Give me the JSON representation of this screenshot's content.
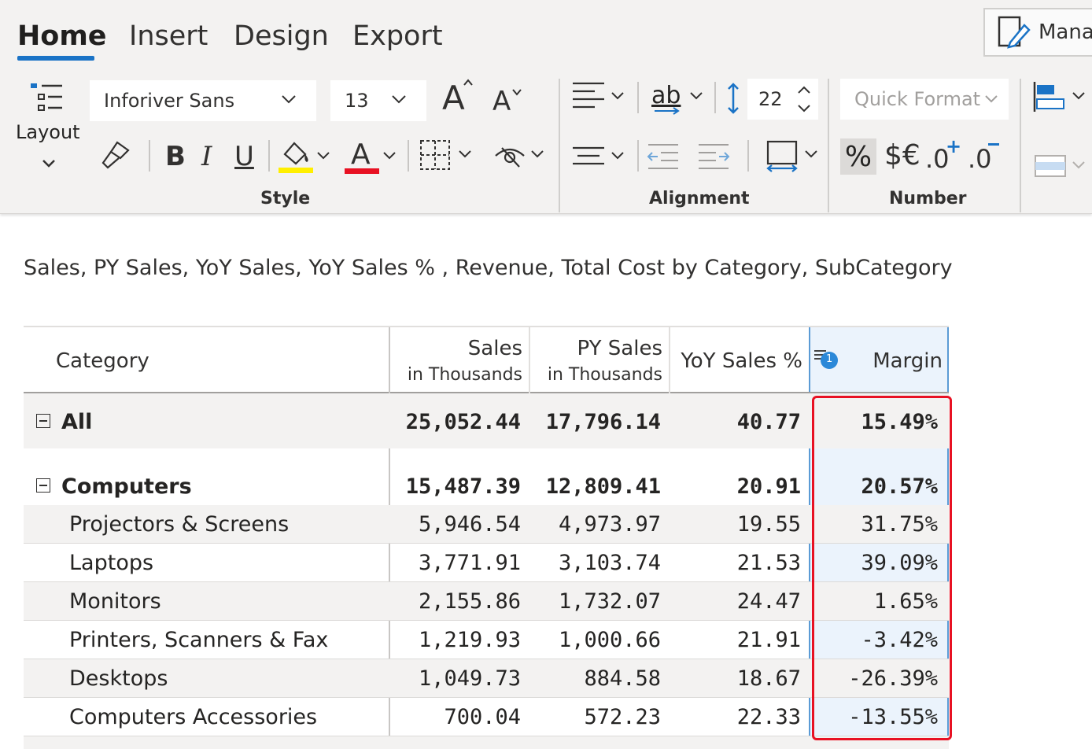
{
  "tabs": [
    {
      "label": "Home",
      "active": true
    },
    {
      "label": "Insert",
      "active": false
    },
    {
      "label": "Design",
      "active": false
    },
    {
      "label": "Export",
      "active": false
    }
  ],
  "manage_button": {
    "label": "Manag"
  },
  "ribbon": {
    "layout_label": "Layout",
    "font_family": "Inforiver Sans",
    "font_size": "13",
    "bold_label": "B",
    "italic_label": "I",
    "underline_label": "U",
    "increase_font": "A",
    "decrease_font": "A",
    "font_color_letter": "A",
    "wrap_label": "ab",
    "row_height": "22",
    "quick_format_placeholder": "Quick Format",
    "percent_label": "%",
    "currency_label": "$€",
    "inc_decimal_label": ".0",
    "dec_decimal_label": ".0",
    "groups": {
      "style": "Style",
      "alignment": "Alignment",
      "number": "Number"
    }
  },
  "colors": {
    "accent": "#1a73c6",
    "highlight_fill": "#ffef00",
    "font_color_bar": "#e81123",
    "selection_border": "#e81123",
    "margin_column_border": "#5b9bd5"
  },
  "report": {
    "subtitle": "Sales, PY Sales, YoY Sales, YoY Sales % , Revenue, Total Cost by Category, SubCategory",
    "sort_badge": "1",
    "columns": [
      {
        "label": "Category",
        "sub": ""
      },
      {
        "label": "Sales",
        "sub": "in Thousands"
      },
      {
        "label": "PY Sales",
        "sub": "in Thousands"
      },
      {
        "label": "YoY Sales %",
        "sub": ""
      },
      {
        "label": "Margin",
        "sub": ""
      }
    ],
    "rows": [
      {
        "category": "All",
        "sales": "25,052.44",
        "py_sales": "17,796.14",
        "yoy": "40.77",
        "margin": "15.49%"
      },
      {
        "category": "Computers",
        "sales": "15,487.39",
        "py_sales": "12,809.41",
        "yoy": "20.91",
        "margin": "20.57%"
      },
      {
        "category": "Projectors & Screens",
        "sales": "5,946.54",
        "py_sales": "4,973.97",
        "yoy": "19.55",
        "margin": "31.75%"
      },
      {
        "category": "Laptops",
        "sales": "3,771.91",
        "py_sales": "3,103.74",
        "yoy": "21.53",
        "margin": "39.09%"
      },
      {
        "category": "Monitors",
        "sales": "2,155.86",
        "py_sales": "1,732.07",
        "yoy": "24.47",
        "margin": "1.65%"
      },
      {
        "category": "Printers, Scanners & Fax",
        "sales": "1,219.93",
        "py_sales": "1,000.66",
        "yoy": "21.91",
        "margin": "-3.42%"
      },
      {
        "category": "Desktops",
        "sales": "1,049.73",
        "py_sales": "884.58",
        "yoy": "18.67",
        "margin": "-26.39%"
      },
      {
        "category": "Computers Accessories",
        "sales": "700.04",
        "py_sales": "572.23",
        "yoy": "22.33",
        "margin": "-13.55%"
      }
    ]
  }
}
